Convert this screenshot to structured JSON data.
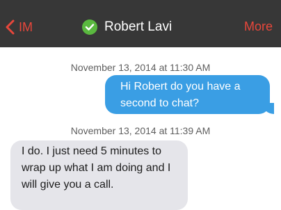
{
  "nav": {
    "back_label": "IM",
    "title": "Robert Lavi",
    "more_label": "More",
    "status_icon": "verified-check-icon"
  },
  "colors": {
    "nav_bg": "#373737",
    "accent": "#e8473b",
    "outgoing_bubble": "#3a9ee4",
    "incoming_bubble": "#e5e5ea",
    "status_green": "#5ab83f"
  },
  "messages": [
    {
      "timestamp": "November 13, 2014 at 11:30 AM",
      "direction": "outgoing",
      "text": "Hi Robert do you have a second to chat?"
    },
    {
      "timestamp": "November 13, 2014 at 11:39 AM",
      "direction": "incoming",
      "text": "I do. I just need 5 minutes to wrap up what I am doing and I will give you a call."
    }
  ]
}
